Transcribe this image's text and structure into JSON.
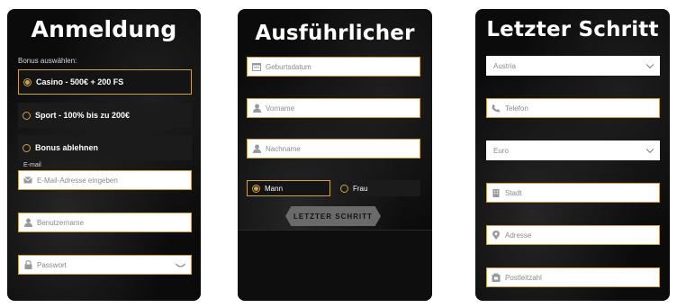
{
  "step1": {
    "title": "Anmeldung",
    "bonus_label": "Bonus auswählen:",
    "options": [
      {
        "label": "Casino - 500€ + 200 FS",
        "selected": true
      },
      {
        "label": "Sport - 100% bis zu 200€",
        "selected": false
      },
      {
        "label": "Bonus ablehnen",
        "selected": false
      }
    ],
    "email_label": "E-mail",
    "email_placeholder": "E-Mail-Adresse eingeben",
    "username_placeholder": "Benutzername",
    "password_placeholder": "Passwort"
  },
  "step2": {
    "title": "Ausführlicher",
    "birthdate_placeholder": "Geburtsdatum",
    "firstname_placeholder": "Vorname",
    "lastname_placeholder": "Nachname",
    "gender_options": [
      {
        "label": "Mann",
        "selected": true
      },
      {
        "label": "Frau",
        "selected": false
      }
    ],
    "next_button": "LETZTER SCHRITT"
  },
  "step3": {
    "title": "Letzter Schritt",
    "country_value": "Austria",
    "phone_placeholder": "Telefon",
    "currency_value": "Euro",
    "city_placeholder": "Stadt",
    "address_placeholder": "Adresse",
    "postal_placeholder": "Postleitzahl"
  },
  "colors": {
    "accent": "#c9a24a",
    "panel_bg": "#0b0b0b",
    "field_bg": "#ffffff",
    "button_bg": "#6a6a6a"
  }
}
